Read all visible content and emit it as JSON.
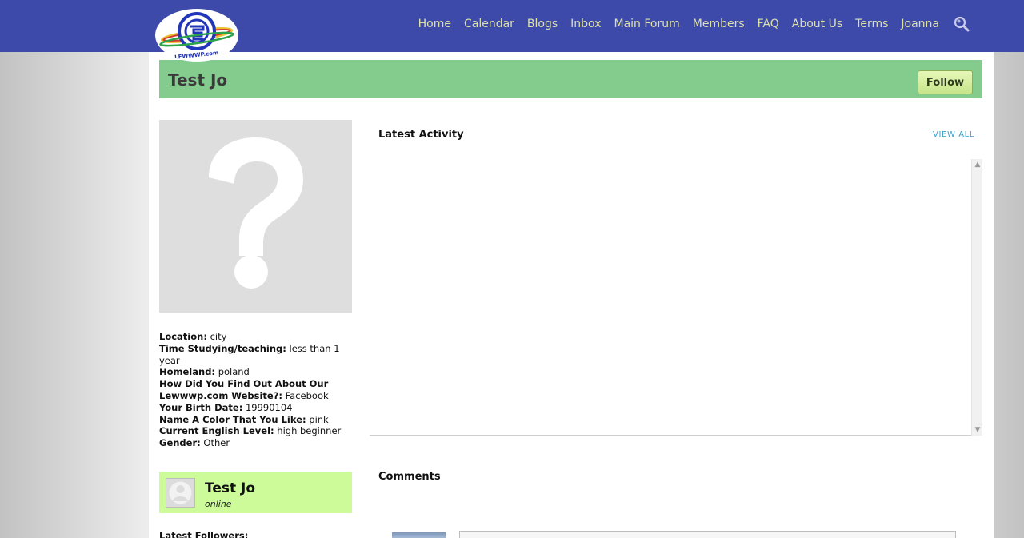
{
  "logo": {
    "text": "LEWWWP.com"
  },
  "nav": {
    "items": [
      "Home",
      "Calendar",
      "Blogs",
      "Inbox",
      "Main Forum",
      "Members",
      "FAQ",
      "About Us",
      "Terms",
      "Joanna"
    ]
  },
  "profile": {
    "name": "Test Jo",
    "follow_label": "Follow",
    "fields": [
      {
        "label": "Location:",
        "value": "city"
      },
      {
        "label": "Time Studying/teaching:",
        "value": "less than 1 year"
      },
      {
        "label": "Homeland:",
        "value": "poland"
      },
      {
        "label": "How Did You Find Out About Our Lewwwp.com Website?:",
        "value": "Facebook"
      },
      {
        "label": "Your Birth Date:",
        "value": "19990104"
      },
      {
        "label": "Name A Color That You Like:",
        "value": "pink"
      },
      {
        "label": "Current English Level:",
        "value": "high beginner"
      },
      {
        "label": "Gender:",
        "value": "Other"
      }
    ],
    "online_name": "Test Jo",
    "online_status": "online",
    "followers_label": "Latest Followers:"
  },
  "activity": {
    "title": "Latest Activity",
    "view_all": "VIEW ALL"
  },
  "comments": {
    "title": "Comments"
  },
  "colors": {
    "topbar": "#3e4aa9",
    "nav_text": "#dde0a8",
    "header_green": "#84cc8e",
    "online_green": "#cdfb9a",
    "link_blue": "#3aa0c8"
  }
}
